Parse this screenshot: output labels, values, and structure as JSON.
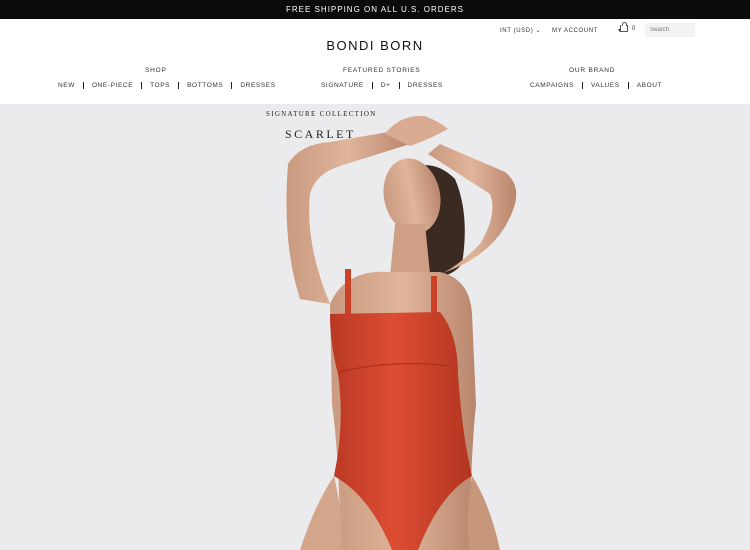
{
  "promo": {
    "text": "FREE SHIPPING ON ALL U.S. ORDERS"
  },
  "header": {
    "logo": "BONDI BORN",
    "currency": "INT (USD) ⌄",
    "account": "MY ACCOUNT",
    "account_caret": "▾",
    "cart_count": "0",
    "search_placeholder": "Search"
  },
  "nav": {
    "shop": {
      "title": "SHOP",
      "items": [
        "NEW",
        "ONE-PIECE",
        "TOPS",
        "BOTTOMS",
        "DRESSES"
      ]
    },
    "stories": {
      "title": "FEATURED STORIES",
      "items": [
        "SIGNATURE",
        "D+",
        "DRESSES"
      ]
    },
    "brand": {
      "title": "OUR BRAND",
      "items": [
        "CAMPAIGNS",
        "VALUES",
        "ABOUT"
      ]
    }
  },
  "hero": {
    "collection": "SIGNATURE COLLECTION",
    "title": "SCARLET",
    "swimsuit_color": "#d6452c"
  }
}
